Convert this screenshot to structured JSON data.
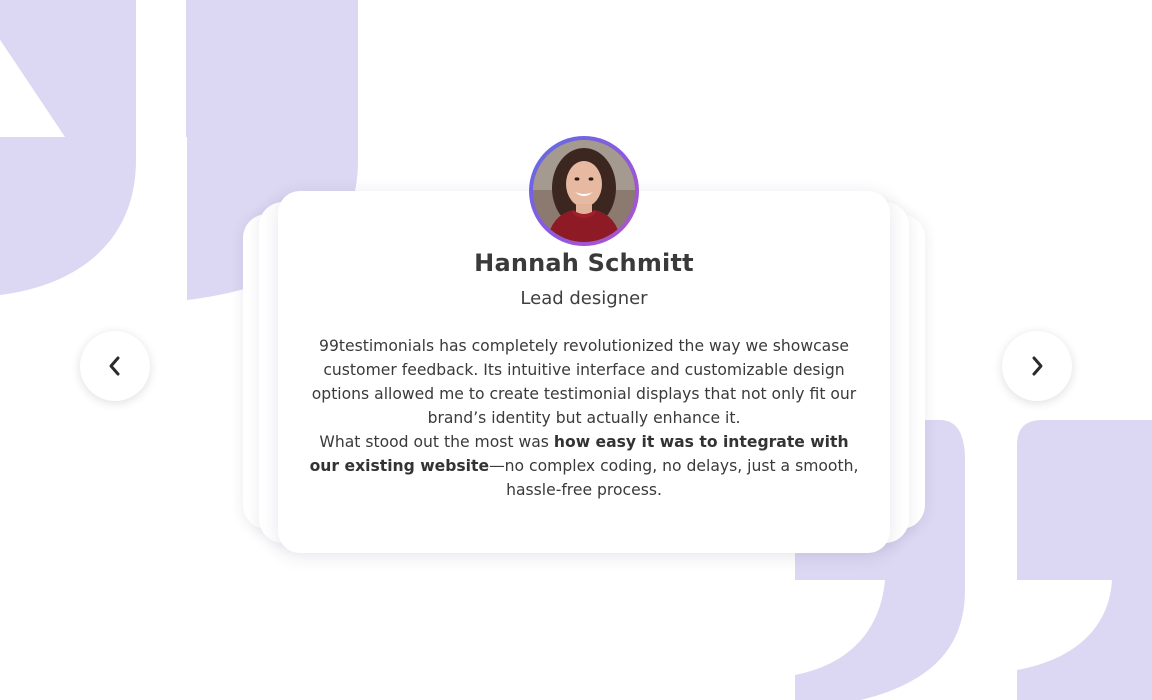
{
  "testimonial": {
    "name": "Hannah Schmitt",
    "role": "Lead designer",
    "paragraph_1": "99testimonials has completely revolutionized the way we showcase customer feedback. Its intuitive interface and customizable design options allowed me to create testimonial displays that not only fit our brand’s identity but actually enhance it.",
    "paragraph_2_lead": "What stood out the most was ",
    "paragraph_2_bold": "how easy it was to integrate with our existing website",
    "paragraph_2_tail": "—no complex coding, no delays, just a smooth, hassle-free process."
  },
  "navigation": {
    "prev_icon": "chevron-left-icon",
    "next_icon": "chevron-right-icon"
  },
  "decor": {
    "quote_icon": "quote-mark-icon"
  },
  "colors": {
    "quote_mark": "#dcd8f3",
    "avatar_ring_start": "#5c6ee8",
    "avatar_ring_end": "#b452c8",
    "text": "#3a3a3a",
    "card_bg": "#ffffff"
  }
}
